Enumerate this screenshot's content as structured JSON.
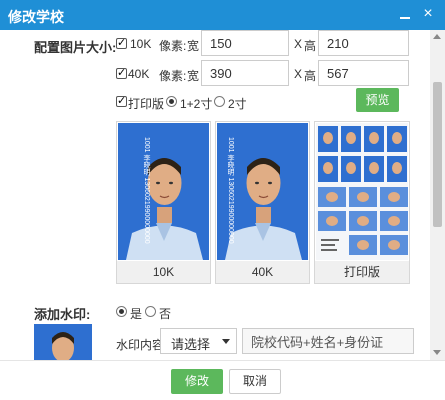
{
  "window": {
    "title": "修改学校",
    "minimize_label": "minimize",
    "close_glyph": "×"
  },
  "photo_size": {
    "label": "配置图片大小:",
    "row_10k": {
      "checked": true,
      "name": "10K",
      "pixel_label": "像素:",
      "width_label": "宽",
      "width_value": "150",
      "times_label": "X",
      "height_label": "高",
      "height_value": "210"
    },
    "row_40k": {
      "checked": true,
      "name": "40K",
      "pixel_label": "像素:",
      "width_label": "宽",
      "width_value": "390",
      "times_label": "X",
      "height_label": "高",
      "height_value": "567"
    },
    "print": {
      "checked": true,
      "label": "打印版",
      "option_1": "1+2寸",
      "option_1_selected": true,
      "option_2": "2寸",
      "option_2_selected": false
    },
    "preview_button": "预览"
  },
  "previews": [
    {
      "caption": "10K",
      "side_text": "1001 李晓明 13060219900000000"
    },
    {
      "caption": "40K",
      "side_text": "1001 李晓明 13060219900000000"
    },
    {
      "caption": "打印版"
    }
  ],
  "watermark": {
    "label": "添加水印:",
    "yes_label": "是",
    "yes_selected": true,
    "no_label": "否",
    "no_selected": false,
    "content_label": "水印内容:",
    "select_value": "请选择",
    "content_value": "院校代码+姓名+身份证"
  },
  "footer": {
    "save_label": "修改",
    "cancel_label": "取消"
  },
  "colors": {
    "titlebar": "#1f8fd6",
    "photo_background": "#2e6fd0",
    "green_button": "#5cb85c"
  }
}
